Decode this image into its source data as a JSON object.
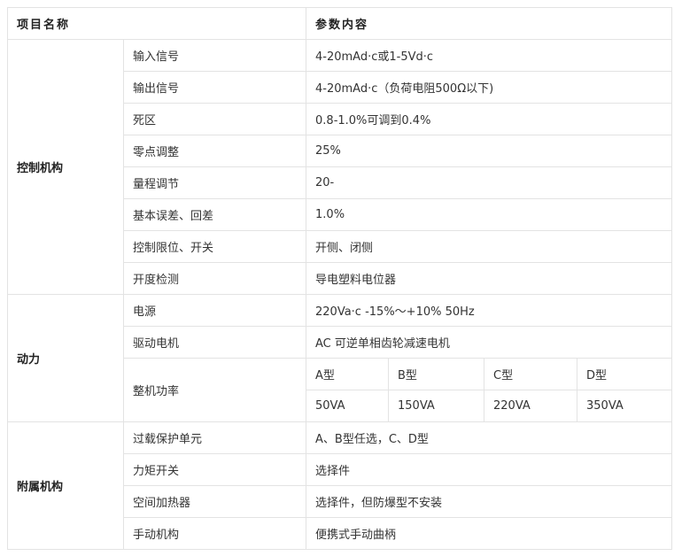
{
  "header": {
    "col1": "项目名称",
    "col2": "参数内容"
  },
  "groups": {
    "control": {
      "label": "控制机构",
      "rows": [
        {
          "item": "输入信号",
          "value": "4-20mAd·c或1-5Vd·c"
        },
        {
          "item": "输出信号",
          "value": "4-20mAd·c（负荷电阻500Ω以下)"
        },
        {
          "item": "死区",
          "value": "0.8-1.0%可调到0.4%"
        },
        {
          "item": "零点调整",
          "value": "25%"
        },
        {
          "item": "量程调节",
          "value": "20-"
        },
        {
          "item": "基本误差、回差",
          "value": "1.0%"
        },
        {
          "item": "控制限位、开关",
          "value": "开侧、闭侧"
        },
        {
          "item": "开度检测",
          "value": "导电塑料电位器"
        }
      ]
    },
    "power": {
      "label": "动力",
      "rows": [
        {
          "item": "电源",
          "value": "220Va·c -15%～+10%  50Hz"
        },
        {
          "item": "驱动电机",
          "value": "AC 可逆单相齿轮减速电机"
        }
      ],
      "unit_power": {
        "item": "整机功率",
        "types": [
          "A型",
          "B型",
          "C型",
          "D型"
        ],
        "values": [
          "50VA",
          "150VA",
          "220VA",
          "350VA"
        ]
      }
    },
    "accessory": {
      "label": "附属机构",
      "rows": [
        {
          "item": "过载保护单元",
          "value": "A、B型任选，C、D型"
        },
        {
          "item": "力矩开关",
          "value": "选择件"
        },
        {
          "item": "空间加热器",
          "value": "选择件，但防爆型不安装"
        },
        {
          "item": "手动机构",
          "value": "便携式手动曲柄"
        }
      ]
    }
  }
}
